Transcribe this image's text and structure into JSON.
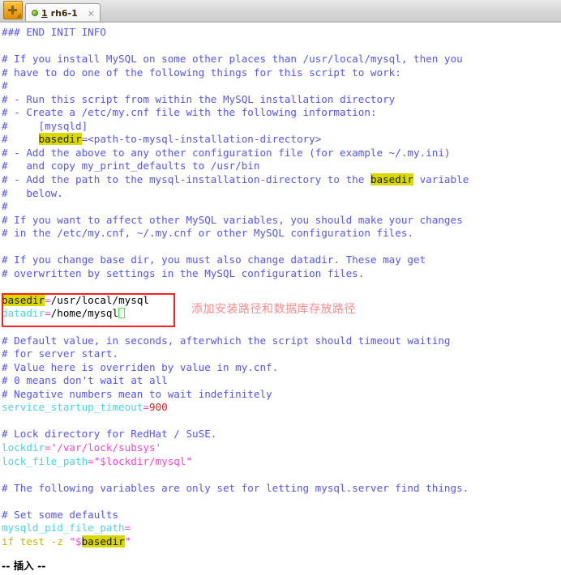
{
  "window": {
    "tabbar": {
      "new_tab_button": "+",
      "new_tab_icon": "plus-icon",
      "tabs": [
        {
          "status_icon": "green-dot-icon",
          "number": "1",
          "label": "rh6-1",
          "close_icon": "×",
          "active": true
        }
      ]
    }
  },
  "editor": {
    "lines": [
      {
        "id": "l1",
        "segments": [
          {
            "t": "### END INIT INFO",
            "c": "cmt"
          }
        ]
      },
      {
        "id": "l2",
        "segments": []
      },
      {
        "id": "l3",
        "segments": [
          {
            "t": "# If you install MySQL on some other places than /usr/local/mysql, then you",
            "c": "cmt"
          }
        ]
      },
      {
        "id": "l4",
        "segments": [
          {
            "t": "# have to do one of the following things for this script to work:",
            "c": "cmt"
          }
        ]
      },
      {
        "id": "l5",
        "segments": [
          {
            "t": "#",
            "c": "cmt"
          }
        ]
      },
      {
        "id": "l6",
        "segments": [
          {
            "t": "# - Run this script from within the MySQL installation directory",
            "c": "cmt"
          }
        ]
      },
      {
        "id": "l7",
        "segments": [
          {
            "t": "# - Create a /etc/my.cnf file with the following information:",
            "c": "cmt"
          }
        ]
      },
      {
        "id": "l8",
        "segments": [
          {
            "t": "#     [mysqld]",
            "c": "cmt"
          }
        ]
      },
      {
        "id": "l9",
        "segments": [
          {
            "t": "#     ",
            "c": "cmt"
          },
          {
            "t": "basedir",
            "c": "hl"
          },
          {
            "t": "=<path-to-mysql-installation-directory>",
            "c": "cmt"
          }
        ]
      },
      {
        "id": "l10",
        "segments": [
          {
            "t": "# - Add the above to any other configuration file (for example ~/.my.ini)",
            "c": "cmt"
          }
        ]
      },
      {
        "id": "l11",
        "segments": [
          {
            "t": "#   and copy my_print_defaults to /usr/bin",
            "c": "cmt"
          }
        ]
      },
      {
        "id": "l12",
        "segments": [
          {
            "t": "# - Add the path to the mysql-installation-directory to the ",
            "c": "cmt"
          },
          {
            "t": "basedir",
            "c": "hl"
          },
          {
            "t": " variable",
            "c": "cmt"
          }
        ]
      },
      {
        "id": "l13",
        "segments": [
          {
            "t": "#   below.",
            "c": "cmt"
          }
        ]
      },
      {
        "id": "l14",
        "segments": [
          {
            "t": "#",
            "c": "cmt"
          }
        ]
      },
      {
        "id": "l15",
        "segments": [
          {
            "t": "# If you want to affect other MySQL variables, you should make your changes",
            "c": "cmt"
          }
        ]
      },
      {
        "id": "l16",
        "segments": [
          {
            "t": "# in the /etc/my.cnf, ~/.my.cnf or other MySQL configuration files.",
            "c": "cmt"
          }
        ]
      },
      {
        "id": "l17",
        "segments": []
      },
      {
        "id": "l18",
        "segments": [
          {
            "t": "# If you change base dir, you must also change datadir. These may get",
            "c": "cmt"
          }
        ]
      },
      {
        "id": "l19",
        "segments": [
          {
            "t": "# overwritten by settings in the MySQL configuration files.",
            "c": "cmt"
          }
        ]
      },
      {
        "id": "l20",
        "segments": []
      },
      {
        "id": "l21",
        "segments": [
          {
            "t": "basedir",
            "c": "hl"
          },
          {
            "t": "=",
            "c": "op"
          },
          {
            "t": "/usr/local/mysql",
            "c": "plain"
          }
        ]
      },
      {
        "id": "l22",
        "segments": [
          {
            "t": "datadir",
            "c": "var"
          },
          {
            "t": "=",
            "c": "op"
          },
          {
            "t": "/home/mysql",
            "c": "plain"
          },
          {
            "t": "",
            "c": "cursor"
          }
        ]
      },
      {
        "id": "l23",
        "segments": []
      },
      {
        "id": "l24",
        "segments": [
          {
            "t": "# Default value, in seconds, afterwhich the script should timeout waiting",
            "c": "cmt"
          }
        ]
      },
      {
        "id": "l25",
        "segments": [
          {
            "t": "# for server start.",
            "c": "cmt"
          }
        ]
      },
      {
        "id": "l26",
        "segments": [
          {
            "t": "# Value here is overriden by value in my.cnf.",
            "c": "cmt"
          }
        ]
      },
      {
        "id": "l27",
        "segments": [
          {
            "t": "# 0 means don't wait at all",
            "c": "cmt"
          }
        ]
      },
      {
        "id": "l28",
        "segments": [
          {
            "t": "# Negative numbers mean to wait indefinitely",
            "c": "cmt"
          }
        ]
      },
      {
        "id": "l29",
        "segments": [
          {
            "t": "service_startup_timeout",
            "c": "var"
          },
          {
            "t": "=",
            "c": "op"
          },
          {
            "t": "900",
            "c": "num"
          }
        ]
      },
      {
        "id": "l30",
        "segments": []
      },
      {
        "id": "l31",
        "segments": [
          {
            "t": "# Lock directory for RedHat / SuSE.",
            "c": "cmt"
          }
        ]
      },
      {
        "id": "l32",
        "segments": [
          {
            "t": "lockdir",
            "c": "var"
          },
          {
            "t": "='/var/lock/subsys'",
            "c": "op"
          }
        ]
      },
      {
        "id": "l33",
        "segments": [
          {
            "t": "lock_file_path",
            "c": "var"
          },
          {
            "t": "=\"$lockdir/mysql\"",
            "c": "op"
          }
        ]
      },
      {
        "id": "l34",
        "segments": []
      },
      {
        "id": "l35",
        "segments": [
          {
            "t": "# The following variables are only set for letting mysql.server find things.",
            "c": "cmt"
          }
        ]
      },
      {
        "id": "l36",
        "segments": []
      },
      {
        "id": "l37",
        "segments": [
          {
            "t": "# Set some defaults",
            "c": "cmt"
          }
        ]
      },
      {
        "id": "l38",
        "segments": [
          {
            "t": "mysqld_pid_file_path",
            "c": "var"
          },
          {
            "t": "=",
            "c": "op"
          }
        ]
      },
      {
        "id": "l39",
        "segments": [
          {
            "t": "if test -z ",
            "c": "kw"
          },
          {
            "t": "\"",
            "c": "op"
          },
          {
            "t": "$",
            "c": "op"
          },
          {
            "t": "basedir",
            "c": "hl"
          },
          {
            "t": "\"",
            "c": "op"
          }
        ]
      }
    ],
    "annotation": {
      "text": "添加安装路径和数据库存放路径",
      "color": "#ff8a8a"
    },
    "highlight_box": {
      "color": "#ff2020"
    },
    "cursor": {
      "color": "#44e844"
    }
  },
  "status": {
    "mode": "-- 插入 --"
  }
}
